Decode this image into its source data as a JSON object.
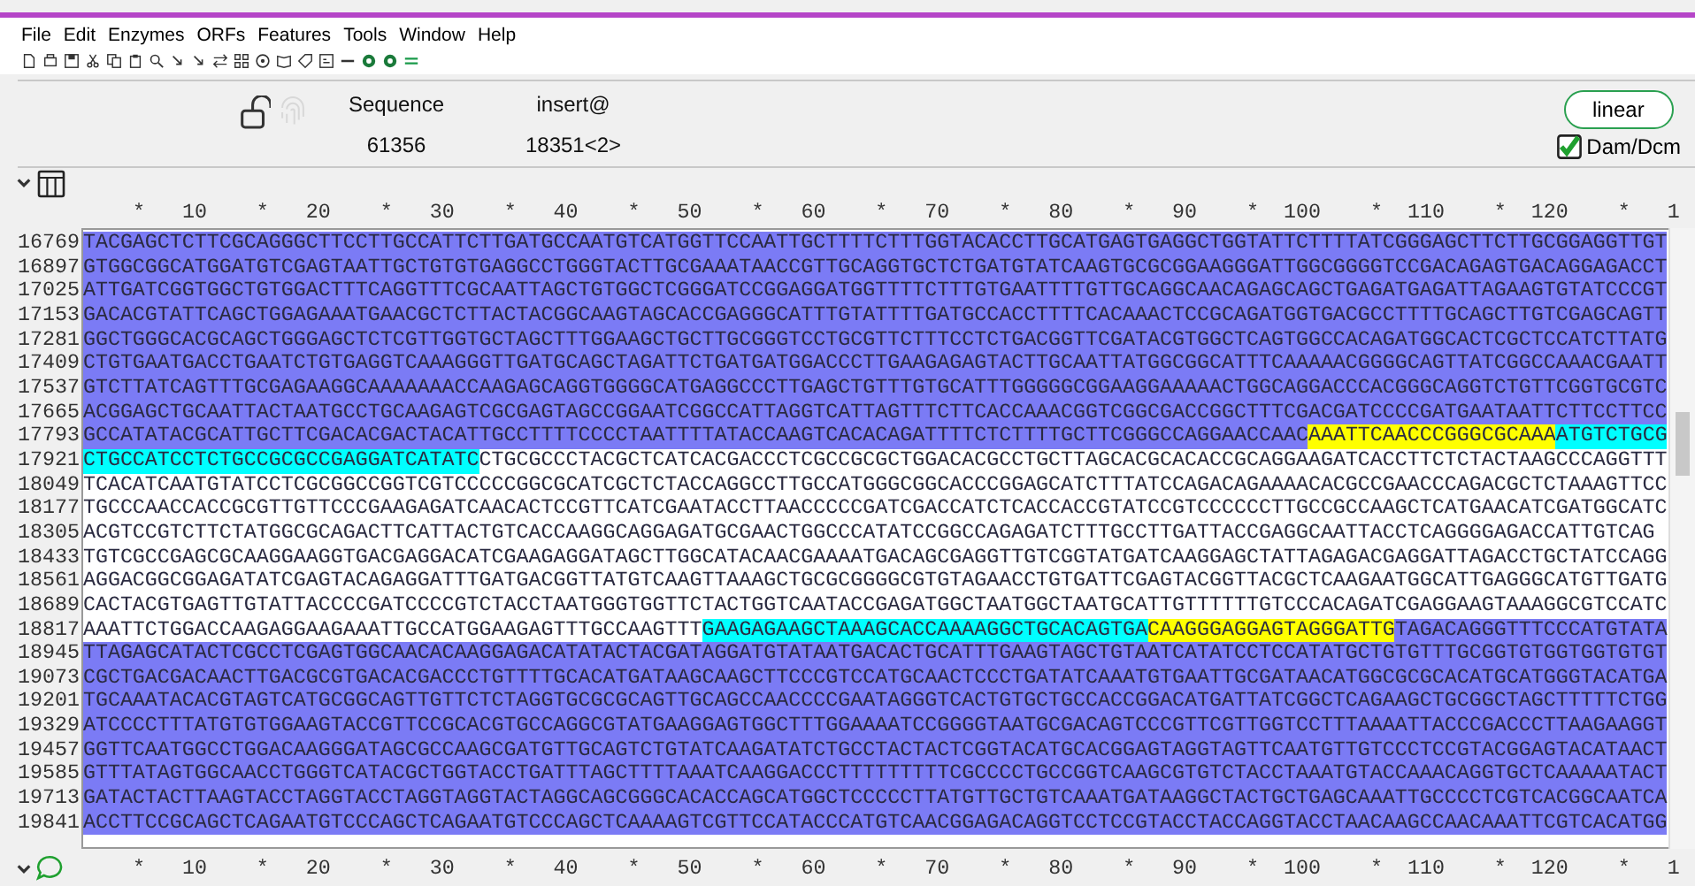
{
  "menu": [
    "File",
    "Edit",
    "Enzymes",
    "ORFs",
    "Features",
    "Tools",
    "Window",
    "Help"
  ],
  "info": {
    "locked": false,
    "fields": [
      {
        "label": "Sequence",
        "value": "61356"
      },
      {
        "label": "insert@",
        "value": "18351<2>"
      }
    ]
  },
  "topology_button": "linear",
  "dam_dcm": {
    "label": "Dam/Dcm",
    "checked": true
  },
  "ruler_top": "    *   10    *   20    *   30    *   40    *   50    *   60    *   70    *   80    *   90    *  100    *  110    *  120    *   1",
  "rows": [
    {
      "number": "16769",
      "segments": [
        {
          "text": "TACGAGCTCTTCGCAGGGCTTCCTTGCCATTCTTGATGCCAATGTCATGGTTCCAATTGCTTTTCTTTGGTACACCTTGCATGAGTGAGGCTGGTATTCTTTTATCGGGAGCTTCTTGCGGAGGTTGT",
          "color": "#7b7bf5"
        }
      ]
    },
    {
      "number": "16897",
      "segments": [
        {
          "text": "GTGGCGGCATGGATGTCGAGTAATTGCTGTGTGAGGCCTGGGTACTTGCGAAATAACCGTTGCAGGTGCTCTGATGTATCAAGTGCGCGGAAGGGATTGGCGGGGTCCGACAGAGTGACAGGAGACCT",
          "color": "#7b7bf5"
        }
      ]
    },
    {
      "number": "17025",
      "segments": [
        {
          "text": "ATTGATCGGTGGCTGTGGACTTTCAGGTTTCGCAATTAGCTGTGGCTCGGGATCCGGAGGATGGTTTTCTTTGTGAATTTTGTTGCAGGCAACAGAGCAGCTGAGATGAGATTAGAAGTGTATCCCGT",
          "color": "#7b7bf5"
        }
      ]
    },
    {
      "number": "17153",
      "segments": [
        {
          "text": "GACACGTATTCAGCTGGAGAAATGAACGCTCTTACTACGGCAAGTAGCACCGAGGGCATTTGTATTTTGATGCCACCTTTTCACAAACTCCGCAGATGGTGACGCCTTTTGCAGCTTGTCGAGCAGTT",
          "color": "#7b7bf5"
        }
      ]
    },
    {
      "number": "17281",
      "segments": [
        {
          "text": "GGCTGGGCACGCAGCTGGGAGCTCTCGTTGGTGCTAGCTTTGGAAGCTGCTTGCGGGTCCTGCGTTCTTTCCTCTGACGGTTCGATACGTGGCTCAGTGGCCACAGATGGCACTCGCTCCATCTTATG",
          "color": "#7b7bf5"
        }
      ]
    },
    {
      "number": "17409",
      "segments": [
        {
          "text": "CTGTGAATGACCTGAATCTGTGAGGTCAAAGGGTTGATGCAGCTAGATTCTGATGATGGACCCTTGAAGAGAGTACTTGCAATTATGGCGGCATTTCAAAAACGGGGCAGTTATCGGCCAAACGAATT",
          "color": "#7b7bf5"
        }
      ]
    },
    {
      "number": "17537",
      "segments": [
        {
          "text": "GTCTTATCAGTTTGCGAGAAGGCAAAAAAACCAAGAGCAGGTGGGGCATGAGGCCCTTGAGCTGTTTGTGCATTTGGGGGCGGAAGGAAAAACTGGCAGGACCCACGGGCAGGTCTGTTCGGTGCGTC",
          "color": "#7b7bf5"
        }
      ]
    },
    {
      "number": "17665",
      "segments": [
        {
          "text": "ACGGAGCTGCAATTACTAATGCCTGCAAGAGTCGCGAGTAGCCGGAATCGGCCATTAGGTCATTAGTTTCTTCACCAAACGGTCGGCGACCGGCTTTCGACGATCCCCGATGAATAATTCTTCCTTCC",
          "color": "#7b7bf5"
        }
      ]
    },
    {
      "number": "17793",
      "segments": [
        {
          "text": "GCCATATACGCATTGCTTCGACACGACTACATTGCCTTTTCCCCTAATTTTATACCAAGTCACACAGATTTTCTCTTTTGCTTCGGGCCAGGAACCAAC",
          "color": "#7b7bf5"
        },
        {
          "text": "AAATTCAACCCGGGCGCAAA",
          "color": "#ffff00"
        },
        {
          "text": "ATGTCTGCG",
          "color": "#00ffff"
        }
      ]
    },
    {
      "number": "17921",
      "segments": [
        {
          "text": "CTGCCATCCTCTGCCGCGCCGAGGATCATATC",
          "color": "#00ffff"
        },
        {
          "text": "CTGCGCCCTACGCTCATCACGACCCTCGCCGCGCTGGACACGCCTGCTTAGCACGCACACCGCAGGAAGATCACCTTCTCTACTAAGCCCAGGTTT"
        }
      ]
    },
    {
      "number": "18049",
      "segments": [
        {
          "text": "TCACATCAATGTATCCTCGCGGCCGGTCGTCCCCCGGCGCATCGCTCTACCAGGCCTTGCCATGGGCGGCACCCGGAGCATCTTTATCCAGACAGAAAACACGCCGAACCCAGACGCTCTAAAGTTCC"
        }
      ]
    },
    {
      "number": "18177",
      "segments": [
        {
          "text": "TGCCCAACCACCGCGTTGTTCCCGAAGAGATCAACACTCCGTTCATCGAATACCTTAACCCCCGATCGACCATCTCACCACCGTATCCGTCCCCCCTTGCCGCCAAGCTCATGAACATCGATGGCATC"
        }
      ]
    },
    {
      "number": "18305",
      "segments": [
        {
          "text": "ACGTCCGTCTTCTATGGCGCAGACTTCATTACTGTCACCAAGGCAGGAGATGCGAACTGGCCCATATCCGGCCAGAGATCTTTGCCTTGATTACCGAGGCAATTACCTCAGGGGAGACCATTGTCAG"
        }
      ]
    },
    {
      "number": "18433",
      "segments": [
        {
          "text": "TGTCGCCGAGCGCAAGGAAGGTGACGAGGACATCGAAGAGGATAGCTTGGCATACAACGAAAATGACAGCGAGGTTGTCGGTATGATCAAGGAGCTATTAGAGACGAGGATTAGACCTGCTATCCAGG"
        }
      ]
    },
    {
      "number": "18561",
      "segments": [
        {
          "text": "AGGACGGCGGAGATATCGAGTACAGAGGATTTGATGACGGTTATGTCAAGTTAAAGCTGCGCGGGGCGTGTAGAACCTGTGATTCGAGTACGGTTACGCTCAAGAATGGCATTGAGGGCATGTTGATG"
        }
      ]
    },
    {
      "number": "18689",
      "segments": [
        {
          "text": "CACTACGTGAGTTGTATTACCCCGATCCCCGTCTACCTAATGGGTGGTTCTACTGGTCAATACCGAGATGGCTAATGGCTAATGCATTGTTTTTTGTCCCACAGATCGAGGAAGTAAAGGCGTCCATC"
        }
      ]
    },
    {
      "number": "18817",
      "segments": [
        {
          "text": "AAATTCTGGACCAAGAGGAAGAAATTGCCATGGAAGAGTTTGCCAAGTTT"
        },
        {
          "text": "GAAGAGAAGCTAAAGCACCAAAAGGCTGCACAGTGA",
          "color": "#00ffff"
        },
        {
          "text": "CAAGGGAGGAGTAGGGATTG",
          "color": "#ffff00"
        },
        {
          "text": "TAGACAGGGTTTCCCATGTATA",
          "color": "#7b7bf5"
        }
      ]
    },
    {
      "number": "18945",
      "segments": [
        {
          "text": "TTAGAGCATACTCGCCTCGAGTGGCAACACAAGGAGACATATACTACGATAGGATGTATAATGACACTGCATTTGAAGTAGCTGTAATCATATCCTCCATATGCTGTGTTTGCGGTGTGGTGGTGTGT",
          "color": "#7b7bf5"
        }
      ]
    },
    {
      "number": "19073",
      "segments": [
        {
          "text": "CGCTGACGACAACTTGACGCGTGACACGACCCTGTTTTGCACATGATAAGCAAGCTTCCCGTCCATGCAACTCCCTGATATCAAATGTGAATTGCGATAACATGGCGCGCACATGCATGGGTACATGA",
          "color": "#7b7bf5"
        }
      ]
    },
    {
      "number": "19201",
      "segments": [
        {
          "text": "TGCAAATACACGTAGTCATGCGGCAGTTGTTCTCTAGGTGCGCGCAGTTGCAGCCAACCCCGAATAGGGTCACTGTGCTGCCACCGGACATGATTATCGGCTCAGAAGCTGCGGCTAGCTTTTTCTGG",
          "color": "#7b7bf5"
        }
      ]
    },
    {
      "number": "19329",
      "segments": [
        {
          "text": "ATCCCCTTTATGTGTGGAAGTACCGTTCCGCACGTGCCAGGCGTATGAAGGAGTGGCTTTGGAAAATCCGGGGTAATGCGACAGTCCCGTTCGTTGGTCCTTTAAAATTACCCGACCCTTAAGAAGGT",
          "color": "#7b7bf5"
        }
      ]
    },
    {
      "number": "19457",
      "segments": [
        {
          "text": "GGTTCAATGGCCTGGACAAGGGATAGCGCCAAGCGATGTTGCAGTCTGTATCAAGATATCTGCCTACTACTCGGTACATGCACGGAGTAGGTAGTTCAATGTTGTCCCTCCGTACGGAGTACATAACT",
          "color": "#7b7bf5"
        }
      ]
    },
    {
      "number": "19585",
      "segments": [
        {
          "text": "GTTTATAGTGGCAACCTGGGTCATACGCTGGTACCTGATTTAGCTTTTAAATCAAGGACCCTTTTTTTTTCGCCCCTGCCGGTCAAGCGTGTCTACCTAAATGTACCAAACAGGTGCTCAAAAATACT",
          "color": "#7b7bf5"
        }
      ]
    },
    {
      "number": "19713",
      "segments": [
        {
          "text": "GATACTACTTAAGTACCTAGGTACCTAGGTAGGTACTAGGCAGCGGGCACACCAGCATGGCTCCCCCTTATGTTGCTGTCAAATGATAAGGCTACTGCTGAGCAAATTGCCCCTCGTCACGGCAATCA",
          "color": "#7b7bf5"
        }
      ]
    },
    {
      "number": "19841",
      "segments": [
        {
          "text": "ACCTTCCGCAGCTCAGAATGTCCCAGCTCAGAATGTCCCAGCTCAAAAGTCGTTCCATACCCATGTCAACGGAGACAGGTCCTCCGTACCTACCAGGTACCTAACAAGCCAACAAATTCGTCACATGG",
          "color": "#7b7bf5"
        }
      ]
    }
  ],
  "ruler_bottom": "    *   10    *   20    *   30    *   40    *   50    *   60    *   70    *   80    *   90    *  100    *  110    *  120    *   1"
}
